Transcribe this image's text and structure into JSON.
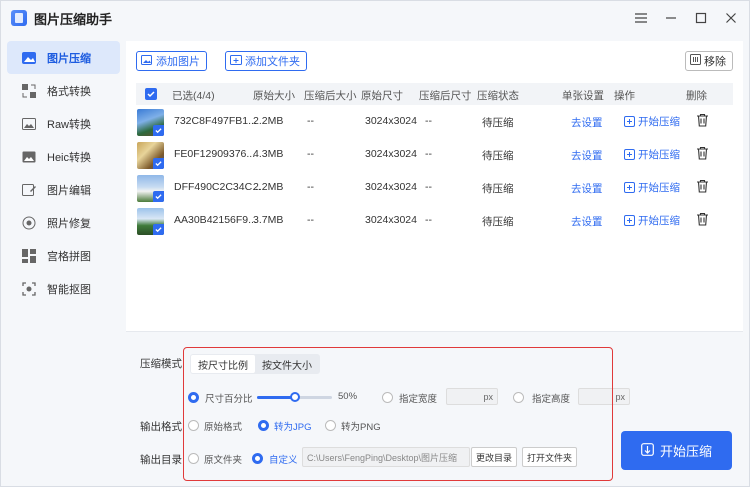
{
  "app": {
    "title": "图片压缩助手"
  },
  "window": {
    "menu_icon": "hamburger-icon",
    "minimize_icon": "minimize-icon",
    "maximize_icon": "maximize-icon",
    "close_icon": "close-icon"
  },
  "sidebar": {
    "items": [
      {
        "label": "图片压缩",
        "icon": "compress-icon",
        "active": true
      },
      {
        "label": "格式转换",
        "icon": "convert-icon",
        "active": false
      },
      {
        "label": "Raw转换",
        "icon": "raw-icon",
        "active": false
      },
      {
        "label": "Heic转换",
        "icon": "heic-icon",
        "active": false
      },
      {
        "label": "图片编辑",
        "icon": "edit-icon",
        "active": false
      },
      {
        "label": "照片修复",
        "icon": "repair-icon",
        "active": false
      },
      {
        "label": "宫格拼图",
        "icon": "grid-icon",
        "active": false
      },
      {
        "label": "智能抠图",
        "icon": "cutout-icon",
        "active": false
      }
    ]
  },
  "toolbar": {
    "add_image": "添加图片",
    "add_folder": "添加文件夹",
    "remove": "移除"
  },
  "table": {
    "headers": {
      "selected": "已选(4/4)",
      "original_size": "原始大小",
      "compressed_size": "压缩后大小",
      "original_dims": "原始尺寸",
      "compressed_dims": "压缩后尺寸",
      "status": "压缩状态",
      "single_settings": "单张设置",
      "actions": "操作",
      "delete": "删除"
    },
    "rows": [
      {
        "name": "732C8F497FB1...",
        "size": "2.2MB",
        "compressed": "--",
        "dims": "3024x3024",
        "compressed_dims": "--",
        "status": "待压缩",
        "settings": "去设置",
        "action": "开始压缩"
      },
      {
        "name": "FE0F12909376...",
        "size": "4.3MB",
        "compressed": "--",
        "dims": "3024x3024",
        "compressed_dims": "--",
        "status": "待压缩",
        "settings": "去设置",
        "action": "开始压缩"
      },
      {
        "name": "DFF490C2C34C...",
        "size": "2.2MB",
        "compressed": "--",
        "dims": "3024x3024",
        "compressed_dims": "--",
        "status": "待压缩",
        "settings": "去设置",
        "action": "开始压缩"
      },
      {
        "name": "AA30B42156F9...",
        "size": "3.7MB",
        "compressed": "--",
        "dims": "3024x3024",
        "compressed_dims": "--",
        "status": "待压缩",
        "settings": "去设置",
        "action": "开始压缩"
      }
    ]
  },
  "settings": {
    "mode_label": "压缩模式",
    "mode_tabs": [
      "按尺寸比例",
      "按文件大小"
    ],
    "size_percent_label": "尺寸百分比",
    "size_percent_value": "50%",
    "slider_value": 50,
    "fixed_width_label": "指定宽度",
    "fixed_height_label": "指定高度",
    "px_unit": "px",
    "output_format_label": "输出格式",
    "formats": [
      "原始格式",
      "转为JPG",
      "转为PNG"
    ],
    "output_dir_label": "输出目录",
    "dir_options": [
      "原文件夹",
      "自定义"
    ],
    "path": "C:\\Users\\FengPing\\Desktop\\图片压缩",
    "change_dir": "更改目录",
    "open_folder": "打开文件夹",
    "start_button": "开始压缩"
  },
  "colors": {
    "accent": "#2f6bf0",
    "highlight_border": "#e03a3a"
  }
}
